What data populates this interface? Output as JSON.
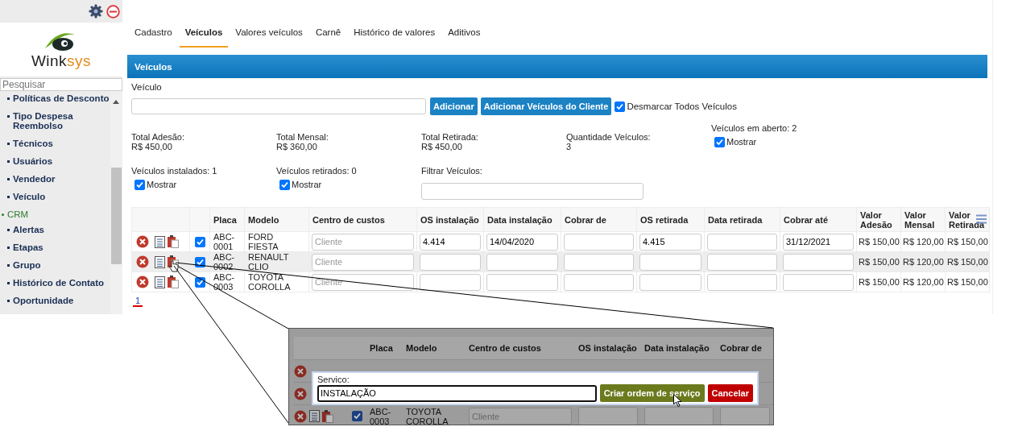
{
  "logo": {
    "text": "Wink",
    "accent": "sys"
  },
  "sidebar": {
    "search_placeholder": "Pesquisar",
    "items": [
      {
        "label": "Políticas de Desconto",
        "kind": "item"
      },
      {
        "label": "Tipo Despesa Reembolso",
        "kind": "item"
      },
      {
        "label": "Técnicos",
        "kind": "item"
      },
      {
        "label": "Usuários",
        "kind": "item"
      },
      {
        "label": "Vendedor",
        "kind": "item"
      },
      {
        "label": "Veículo",
        "kind": "item"
      },
      {
        "label": "CRM",
        "kind": "section"
      },
      {
        "label": "Alertas",
        "kind": "item"
      },
      {
        "label": "Etapas",
        "kind": "item"
      },
      {
        "label": "Grupo",
        "kind": "item"
      },
      {
        "label": "Histórico de Contato",
        "kind": "item"
      },
      {
        "label": "Oportunidade",
        "kind": "item"
      }
    ]
  },
  "tabs": [
    {
      "label": "Cadastro",
      "selected": false
    },
    {
      "label": "Veículos",
      "selected": true
    },
    {
      "label": "Valores veículos",
      "selected": false
    },
    {
      "label": "Carnê",
      "selected": false
    },
    {
      "label": "Histórico de valores",
      "selected": false
    },
    {
      "label": "Aditivos",
      "selected": false
    }
  ],
  "panel": {
    "title": "Veículos",
    "vehicle_label": "Veículo",
    "buttons": [
      "Adicionar",
      "Adicionar Veículos do Cliente"
    ],
    "unmark_all": {
      "label": "Desmarcar Todos Veículos",
      "checked": true
    },
    "totals": [
      {
        "label": "Total Adesão:",
        "value": "R$ 450,00"
      },
      {
        "label": "Total Mensal:",
        "value": "R$ 360,00"
      },
      {
        "label": "Total Retirada:",
        "value": "R$ 450,00"
      },
      {
        "label": "Quantidade Veículos:",
        "value": "3"
      }
    ],
    "open_vehicles": {
      "label": "Veículos em aberto: 2",
      "show_label": "Mostrar",
      "checked": true
    },
    "stats": [
      {
        "label": "Veículos instalados: 1",
        "show_label": "Mostrar",
        "checked": true
      },
      {
        "label": "Veículos retirados: 0",
        "show_label": "Mostrar",
        "checked": true
      }
    ],
    "filter_label": "Filtrar Veículos:"
  },
  "table": {
    "columns": [
      "Placa",
      "Modelo",
      "Centro de custos",
      "OS instalação",
      "Data instalação",
      "Cobrar de",
      "OS retirada",
      "Data retirada",
      "Cobrar até",
      "Valor Adesão",
      "Valor Mensal",
      "Valor Retirada"
    ],
    "rows": [
      {
        "checked": true,
        "highlighted": false,
        "cells": [
          {
            "kind": "text",
            "text": "ABC-0001"
          },
          {
            "kind": "text",
            "text": "FORD FIESTA"
          },
          {
            "kind": "input",
            "placeholder": "Cliente"
          },
          {
            "kind": "input",
            "value": "4.414"
          },
          {
            "kind": "input",
            "value": "14/04/2020"
          },
          {
            "kind": "input"
          },
          {
            "kind": "input",
            "value": "4.415"
          },
          {
            "kind": "input"
          },
          {
            "kind": "input",
            "value": "31/12/2021"
          },
          {
            "kind": "text",
            "text": "R$ 150,00"
          },
          {
            "kind": "text",
            "text": "R$ 120,00"
          },
          {
            "kind": "text",
            "text": "R$ 150,00"
          }
        ]
      },
      {
        "checked": true,
        "highlighted": true,
        "cells": [
          {
            "kind": "text",
            "text": "ABC-0002"
          },
          {
            "kind": "text",
            "text": "RENAULT CLIO"
          },
          {
            "kind": "input",
            "placeholder": "Cliente"
          },
          {
            "kind": "input"
          },
          {
            "kind": "input"
          },
          {
            "kind": "input"
          },
          {
            "kind": "input"
          },
          {
            "kind": "input"
          },
          {
            "kind": "input"
          },
          {
            "kind": "text",
            "text": "R$ 150,00"
          },
          {
            "kind": "text",
            "text": "R$ 120,00"
          },
          {
            "kind": "text",
            "text": "R$ 150,00"
          }
        ]
      },
      {
        "checked": true,
        "highlighted": false,
        "cells": [
          {
            "kind": "text",
            "text": "ABC-0003"
          },
          {
            "kind": "text",
            "text": "TOYOTA COROLLA"
          },
          {
            "kind": "input",
            "placeholder": "Cliente"
          },
          {
            "kind": "input"
          },
          {
            "kind": "input"
          },
          {
            "kind": "input"
          },
          {
            "kind": "input"
          },
          {
            "kind": "input"
          },
          {
            "kind": "input"
          },
          {
            "kind": "text",
            "text": "R$ 150,00"
          },
          {
            "kind": "text",
            "text": "R$ 120,00"
          },
          {
            "kind": "text",
            "text": "R$ 150,00"
          }
        ]
      }
    ]
  },
  "pagination": [
    {
      "label": "1",
      "selected": true
    }
  ],
  "zoom_inset": {
    "columns": [
      "Placa",
      "Modelo",
      "Centro de custos",
      "OS instalação",
      "Data instalação",
      "Cobrar de"
    ],
    "rows": [
      {
        "kind": "covered"
      },
      {
        "kind": "covered"
      },
      {
        "kind": "full",
        "checked": true,
        "placa": "ABC-0003",
        "modelo": "TOYOTA COROLLA",
        "placeholder": "Cliente"
      }
    ],
    "dialog": {
      "label": "Servico:",
      "value": "INSTALAÇÃO",
      "buttons": [
        {
          "label": "Criar ordem de serviço",
          "kind": "confirm"
        },
        {
          "label": "Cancelar",
          "kind": "cancel"
        }
      ]
    }
  }
}
